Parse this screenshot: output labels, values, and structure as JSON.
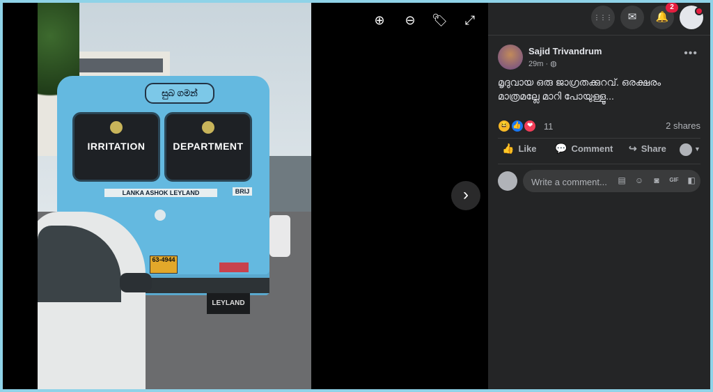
{
  "photo": {
    "bus_top_sign": "සුබ ගමන්",
    "window_left": "IRRITATION",
    "window_right": "DEPARTMENT",
    "maker_plate": "LANKA ASHOK LEYLAND",
    "brand_tag": "BRIJ",
    "plate": "63-4944",
    "mudflap": "LEYLAND"
  },
  "viewer": {
    "zoom_in_icon": "⊕",
    "zoom_out_icon": "⊖",
    "tag_icon": "🏷",
    "fullscreen_icon": "⤢",
    "next_icon": "›"
  },
  "topbar": {
    "menu_icon": "⋮⋮⋮",
    "messenger_icon": "✉",
    "notifications_icon": "🔔",
    "notifications_count": "2"
  },
  "post": {
    "author": "Sajid Trivandrum",
    "time": "29m · ◍",
    "more": "•••",
    "text": "മൃദുവായ ഒരു ജാഗ്രതക്കുറവ്. ഒരക്ഷരം മാത്രമല്ലേ മാറി പോയുള്ളൂ...",
    "reactions": {
      "count": "11",
      "shares": "2 shares",
      "icons": [
        "😆",
        "👍",
        "❤"
      ]
    },
    "actions": {
      "like": "Like",
      "comment": "Comment",
      "share": "Share"
    },
    "comment_placeholder": "Write a comment..."
  },
  "colors": {
    "panel_bg": "#242526",
    "text": "#e4e6eb",
    "muted": "#b0b3b8",
    "badge": "#e41e3f",
    "bus": "#64b9e0"
  }
}
